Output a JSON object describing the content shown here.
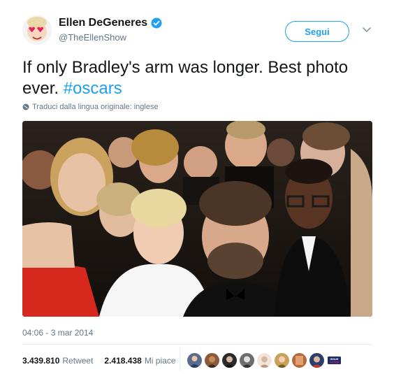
{
  "author": {
    "display_name": "Ellen DeGeneres",
    "handle": "@TheEllenShow",
    "avatar_icon": "ellen-heart-eyes-avatar",
    "verified_icon": "verified-badge-icon"
  },
  "follow_label": "Segui",
  "tweet": {
    "text": "If only Bradley's arm was longer. Best photo ever. ",
    "hashtag": "#oscars"
  },
  "translate_label": "Traduci dalla lingua originale: inglese",
  "timestamp": "04:06 - 3 mar 2014",
  "stats": {
    "retweets_count": "3.439.810",
    "retweets_label": "Retweet",
    "likes_count": "2.418.438",
    "likes_label": "Mi piace"
  },
  "likers": [
    {
      "icon": "liker-avatar",
      "color": "#5a6b8c"
    },
    {
      "icon": "liker-avatar",
      "color": "#8a5a3c"
    },
    {
      "icon": "liker-avatar",
      "color": "#2b2b2b"
    },
    {
      "icon": "liker-avatar",
      "color": "#6e6e6e"
    },
    {
      "icon": "liker-avatar",
      "color": "#d9b8a0"
    },
    {
      "icon": "liker-avatar",
      "color": "#c9a05a"
    },
    {
      "icon": "liker-avatar",
      "color": "#b46a3c"
    },
    {
      "icon": "liker-avatar",
      "color": "#2c3e6b"
    },
    {
      "icon": "issue-voter-avatar",
      "color": "#ffffff",
      "text": "ISSUE VOTER"
    }
  ],
  "colors": {
    "accent": "#1da1f2",
    "text_primary": "#14171a",
    "text_secondary": "#657786",
    "divider": "#e6ecf0"
  }
}
